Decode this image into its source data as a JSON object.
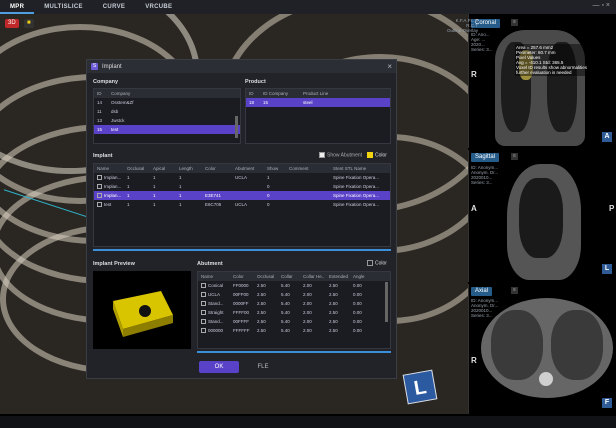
{
  "topbar": {
    "tabs": [
      {
        "label": "MPR"
      },
      {
        "label": "MULTISLICE"
      },
      {
        "label": "CURVE"
      },
      {
        "label": "VRCUBE"
      }
    ],
    "window_controls": "— ▫ ×"
  },
  "view3d": {
    "badge_label": "3D",
    "orientation_letter": "L"
  },
  "coronal": {
    "label": "Coronal",
    "info": [
      "ID: Ano...",
      "Age: ...",
      "2020...",
      "Series: 3..."
    ],
    "measure": [
      "Area = 257.6 mm2",
      "Perimeter: 60.7 mm",
      "Pixel Values",
      "Avg = -410.1 Std: 365.5",
      "Voxel ID results show abnormalities",
      "further evaluation is needed"
    ],
    "header": [
      "K.F.A.P.L.E",
      "R.C.T",
      "Outline Overlay"
    ],
    "left_letter": "R",
    "tag": "A"
  },
  "sagittal": {
    "label": "Sagittal",
    "info": [
      "ID: Anonym...",
      "Anonym. Dr...",
      "2020010...",
      "Series: 3..."
    ],
    "left_letter": "A",
    "right_letter": "P",
    "tag": "L"
  },
  "axial": {
    "label": "Axial",
    "info": [
      "ID: Anonym...",
      "Anonym. Dr...",
      "2020010...",
      "Series: 3..."
    ],
    "left_letter": "R",
    "tag": "F"
  },
  "dialog": {
    "title": "Implant",
    "close": "×",
    "company": {
      "heading": "Company",
      "columns": [
        "ID",
        "Company"
      ],
      "rows": [
        {
          "id": "14",
          "name": "Osstem&Zf"
        },
        {
          "id": "11",
          "name": "dsb"
        },
        {
          "id": "13",
          "name": "Jwstck"
        },
        {
          "id": "15",
          "name": "test"
        }
      ],
      "selected": 3
    },
    "product": {
      "heading": "Product",
      "columns": [
        "ID",
        "ID Company",
        "Product Line"
      ],
      "rows": [
        {
          "id": "18",
          "company": "15",
          "line": "steel"
        }
      ],
      "selected": 0
    },
    "implant": {
      "heading": "Implant",
      "show_abutment_label": "Show Abutment",
      "color_label": "Color",
      "columns": [
        "Name",
        "Occlusal",
        "Apical",
        "Length",
        "Color",
        "Abutment",
        "Show",
        "Comment",
        "Stent STL Name"
      ],
      "rows": [
        {
          "name": "Implan...",
          "occ": "1",
          "api": "1",
          "len": "1",
          "color": "",
          "abut": "UCLA",
          "show": "1",
          "comment": "",
          "stl": "Spine Fixation Opera..."
        },
        {
          "name": "Implan...",
          "occ": "1",
          "api": "1",
          "len": "1",
          "color": "",
          "abut": "",
          "show": "0",
          "comment": "",
          "stl": "Spine Fixation Opera..."
        },
        {
          "name": "Implan...",
          "occ": "1",
          "api": "1",
          "len": "1",
          "color": "E3E741",
          "abut": "",
          "show": "0",
          "comment": "",
          "stl": "Spine Fixation Opera..."
        },
        {
          "name": "test",
          "occ": "1",
          "api": "1",
          "len": "1",
          "color": "E6C705",
          "abut": "UCLA",
          "show": "0",
          "comment": "",
          "stl": "Spine Fixation Opera..."
        }
      ],
      "selected": 2
    },
    "preview": {
      "heading": "Implant Preview"
    },
    "abutment": {
      "heading": "Abutment",
      "color_label": "Color",
      "columns": [
        "Name",
        "Color",
        "Occlusal",
        "Collar",
        "Collar He..",
        "Extended",
        "Angle"
      ],
      "rows": [
        {
          "name": "Conical",
          "color": "FF0000",
          "occ": "2.50",
          "collar": "5.40",
          "ch": "2.00",
          "ext": "2.50",
          "angle": "0.00"
        },
        {
          "name": "UCLA",
          "color": "00FF00",
          "occ": "2.50",
          "collar": "5.40",
          "ch": "2.00",
          "ext": "2.50",
          "angle": "0.00"
        },
        {
          "name": "Stand...",
          "color": "0000FF",
          "occ": "2.50",
          "collar": "5.40",
          "ch": "2.00",
          "ext": "2.50",
          "angle": "0.00"
        },
        {
          "name": "Straight",
          "color": "FFFF00",
          "occ": "2.50",
          "collar": "5.40",
          "ch": "2.00",
          "ext": "2.50",
          "angle": "0.00"
        },
        {
          "name": "Stand...",
          "color": "00FFFF",
          "occ": "2.50",
          "collar": "5.40",
          "ch": "2.00",
          "ext": "2.50",
          "angle": "0.00"
        },
        {
          "name": "000000",
          "color": "FFFFFF",
          "occ": "2.50",
          "collar": "5.40",
          "ch": "2.00",
          "ext": "2.50",
          "angle": "0.00"
        }
      ]
    },
    "ok_label": "OK",
    "cancel_label": "FLE"
  },
  "colors": {
    "accent": "#5a42c8",
    "highlight_yellow": "#f2d311",
    "tab_blue": "#265c8a"
  }
}
